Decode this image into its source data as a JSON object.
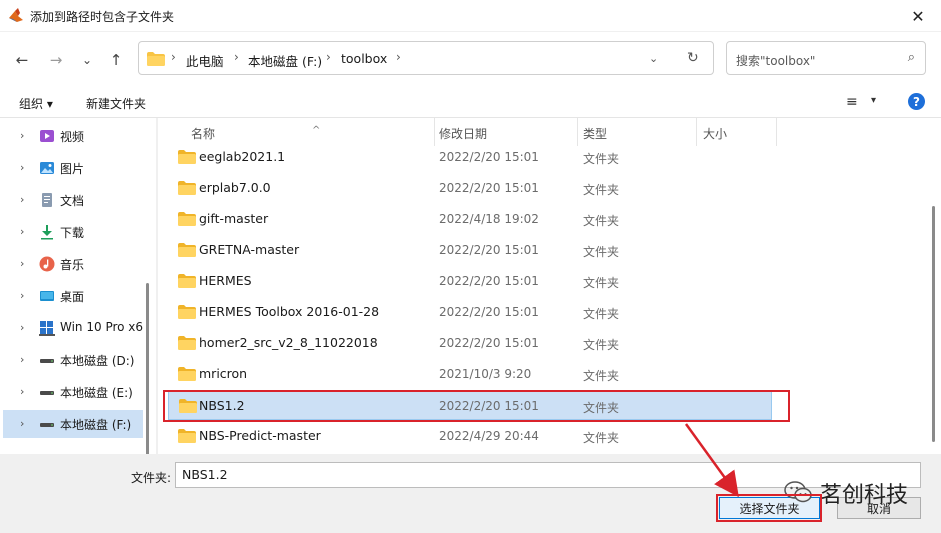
{
  "window": {
    "title": "添加到路径时包含子文件夹",
    "close_glyph": "✕"
  },
  "nav": {
    "back": "←",
    "forward": "→",
    "recent": "⌄",
    "up": "↑",
    "breadcrumbs": [
      "此电脑",
      "本地磁盘 (F:)",
      "toolbox"
    ],
    "separator": "›",
    "dropdown": "⌄",
    "refresh": "↻",
    "search_placeholder": "搜索\"toolbox\"",
    "search_icon": "⌕"
  },
  "toolbar": {
    "organize": "组织 ▾",
    "new_folder": "新建文件夹",
    "view_glyph": "≡",
    "view_dd": "▾",
    "help": "?"
  },
  "sidebar": {
    "items": [
      {
        "label": "视频",
        "icon": "video-icon"
      },
      {
        "label": "图片",
        "icon": "picture-icon"
      },
      {
        "label": "文档",
        "icon": "document-icon"
      },
      {
        "label": "下载",
        "icon": "download-icon"
      },
      {
        "label": "音乐",
        "icon": "music-icon"
      },
      {
        "label": "桌面",
        "icon": "desktop-icon"
      },
      {
        "label": "Win 10 Pro x6",
        "icon": "windows-icon"
      },
      {
        "label": "本地磁盘 (D:)",
        "icon": "drive-icon"
      },
      {
        "label": "本地磁盘 (E:)",
        "icon": "drive-icon"
      },
      {
        "label": "本地磁盘 (F:)",
        "icon": "drive-icon"
      }
    ],
    "chevron": "›"
  },
  "columns": {
    "name": "名称",
    "date": "修改日期",
    "type": "类型",
    "size": "大小",
    "sort_glyph": "^"
  },
  "files": [
    {
      "name": "eeglab2021.1",
      "date": "2022/2/20 15:01",
      "type": "文件夹"
    },
    {
      "name": "erplab7.0.0",
      "date": "2022/2/20 15:01",
      "type": "文件夹"
    },
    {
      "name": "gift-master",
      "date": "2022/4/18 19:02",
      "type": "文件夹"
    },
    {
      "name": "GRETNA-master",
      "date": "2022/2/20 15:01",
      "type": "文件夹"
    },
    {
      "name": "HERMES",
      "date": "2022/2/20 15:01",
      "type": "文件夹"
    },
    {
      "name": "HERMES Toolbox 2016-01-28",
      "date": "2022/2/20 15:01",
      "type": "文件夹"
    },
    {
      "name": "homer2_src_v2_8_11022018",
      "date": "2022/2/20 15:01",
      "type": "文件夹"
    },
    {
      "name": "mricron",
      "date": "2021/10/3 9:20",
      "type": "文件夹"
    },
    {
      "name": "NBS1.2",
      "date": "2022/2/20 15:01",
      "type": "文件夹"
    },
    {
      "name": "NBS-Predict-master",
      "date": "2022/4/29 20:44",
      "type": "文件夹"
    }
  ],
  "bottom": {
    "folder_label": "文件夹:",
    "folder_value": "NBS1.2",
    "select_button": "选择文件夹",
    "cancel_button": "取消"
  },
  "watermark": {
    "text": "茗创科技"
  },
  "colors": {
    "accent": "#0078d7",
    "selection": "#cce0f5",
    "highlight": "#d9232b",
    "folder": "#f8c444"
  }
}
